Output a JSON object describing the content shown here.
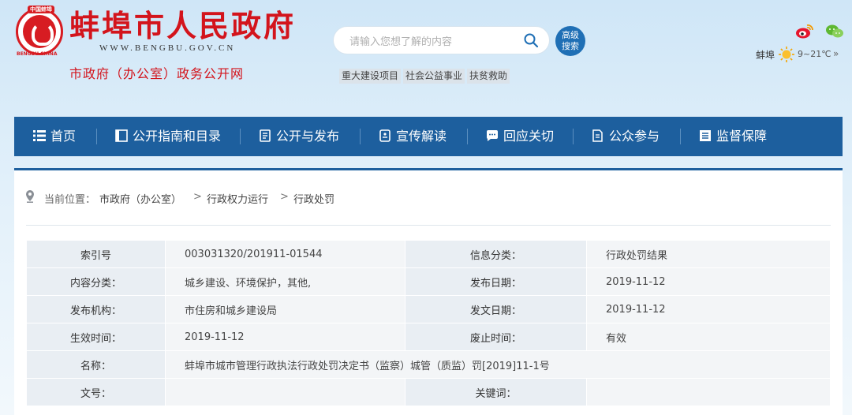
{
  "header": {
    "title": "蚌埠市人民政府",
    "url": "WWW.BENGBU.GOV.CN",
    "subtitle": "市政府（办公室）政务公开网",
    "emblem_top": "中国蚌埠",
    "emblem_bottom": "BENGBU CHINA",
    "search_placeholder": "请输入您想了解的内容",
    "advanced_search_line1": "高级",
    "advanced_search_line2": "搜索",
    "hot_tags": [
      "重大建设项目",
      "社会公益事业",
      "扶贫救助"
    ],
    "weather": {
      "city": "蚌埠",
      "temp": "9~21℃",
      "more": "»"
    }
  },
  "nav": {
    "items": [
      {
        "label": "首页",
        "icon": "list-icon"
      },
      {
        "label": "公开指南和目录",
        "icon": "book-icon"
      },
      {
        "label": "公开与发布",
        "icon": "document-icon"
      },
      {
        "label": "宣传解读",
        "icon": "speaker-icon"
      },
      {
        "label": "回应关切",
        "icon": "chat-icon"
      },
      {
        "label": "公众参与",
        "icon": "edit-icon"
      },
      {
        "label": "监督保障",
        "icon": "report-icon"
      }
    ]
  },
  "breadcrumb": {
    "label": "当前位置：",
    "items": [
      "市政府（办公室）",
      "行政权力运行",
      "行政处罚"
    ],
    "separator": ">"
  },
  "info_table": {
    "rows": [
      {
        "k1": "索引号",
        "v1": "003031320/201911-01544",
        "k2": "信息分类：",
        "v2": "行政处罚结果"
      },
      {
        "k1": "内容分类：",
        "v1": "城乡建设、环境保护，其他,",
        "k2": "发布日期：",
        "v2": "2019-11-12"
      },
      {
        "k1": "发布机构：",
        "v1": "市住房和城乡建设局",
        "k2": "发文日期：",
        "v2": "2019-11-12"
      },
      {
        "k1": "生效时间：",
        "v1": "2019-11-12",
        "k2": "废止时间：",
        "v2": "有效"
      }
    ],
    "name_label": "名称：",
    "name_value": "蚌埠市城市管理行政执法行政处罚决定书（监察）城管（质监）罚[2019]11-1号",
    "doc_no_label": "文号：",
    "doc_no_value": "",
    "keywords_label": "关键词：",
    "keywords_value": ""
  },
  "colors": {
    "brand_red": "#d3141c",
    "nav_blue": "#1d5f9e"
  }
}
